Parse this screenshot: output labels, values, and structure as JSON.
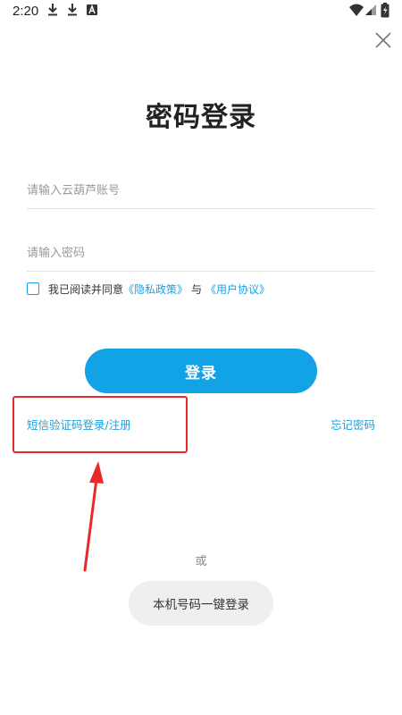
{
  "status_bar": {
    "time": "2:20",
    "icons": [
      "download-icon",
      "download-icon",
      "font-icon",
      "wifi-icon",
      "signal-icon",
      "battery-icon"
    ]
  },
  "close_icon": "close-icon",
  "title": "密码登录",
  "account_field": {
    "placeholder": "请输入云葫芦账号",
    "value": ""
  },
  "password_field": {
    "placeholder": "请输入密码",
    "value": ""
  },
  "agreement": {
    "checked": false,
    "prefix": "我已阅读并同意",
    "privacy_link": "《隐私政策》",
    "conjunction": "与",
    "terms_link": "《用户协议》"
  },
  "login_button": "登录",
  "sms_login_link": "短信验证码登录/注册",
  "forgot_password_link": "忘记密码",
  "or_text": "或",
  "one_click_login_button": "本机号码一键登录",
  "colors": {
    "accent": "#12a2e6",
    "link": "#1a9fe0",
    "annotation": "#e8292b",
    "secondary_button_bg": "#efefef"
  }
}
